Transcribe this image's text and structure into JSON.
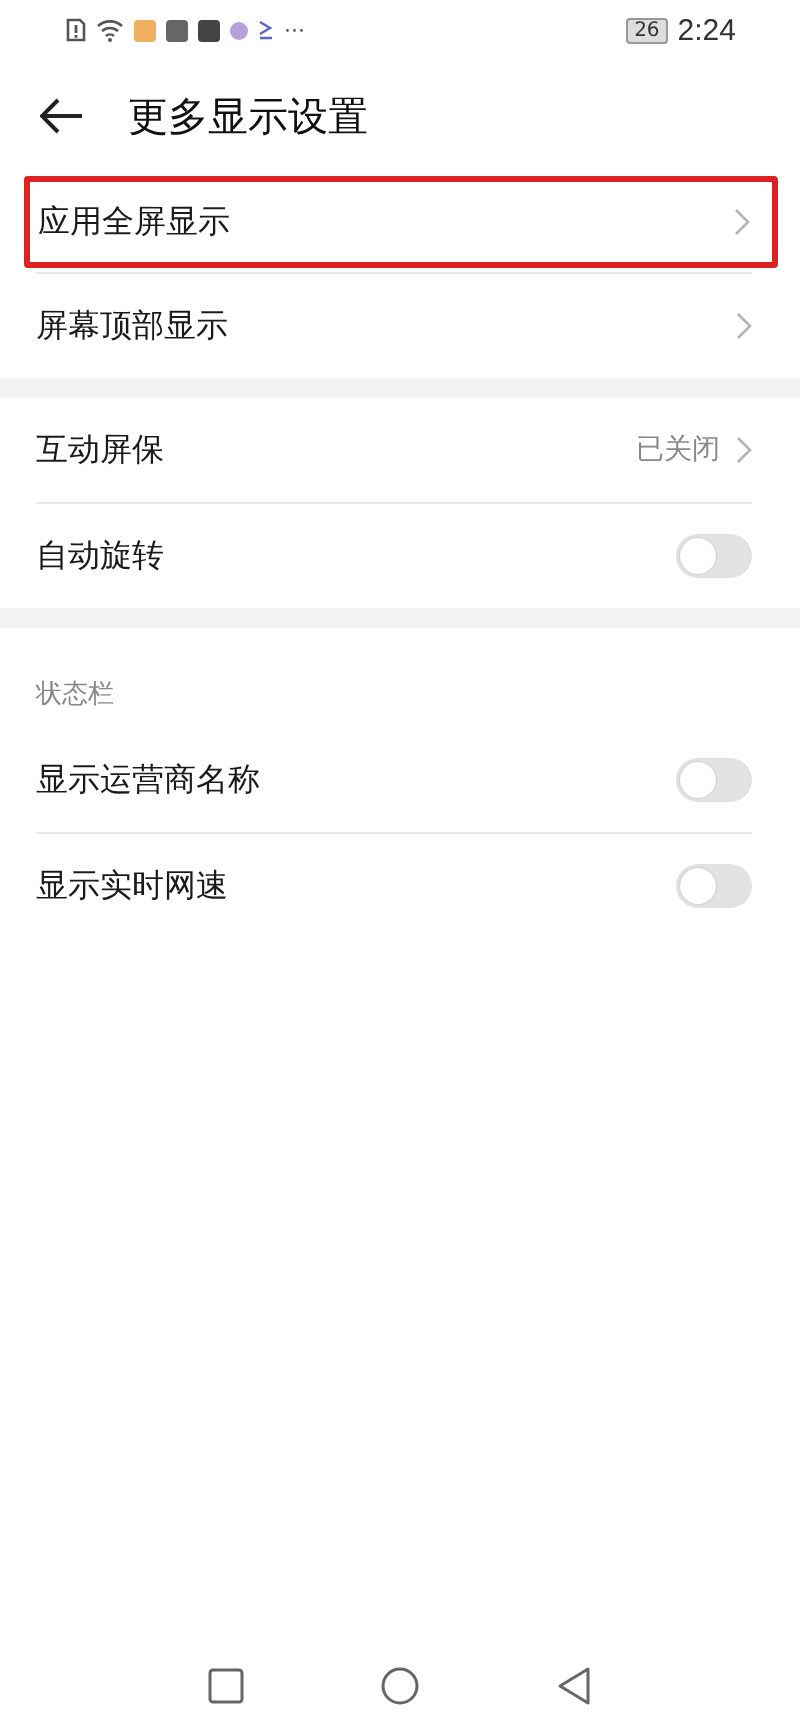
{
  "status_bar": {
    "more": "···",
    "battery": "26",
    "time": "2:24"
  },
  "header": {
    "title": "更多显示设置"
  },
  "groups": [
    {
      "items": [
        {
          "kind": "link",
          "label": "应用全屏显示",
          "highlighted": true
        },
        {
          "kind": "link",
          "label": "屏幕顶部显示",
          "highlighted": false
        }
      ]
    },
    {
      "items": [
        {
          "kind": "link",
          "label": "互动屏保",
          "value": "已关闭",
          "highlighted": false
        },
        {
          "kind": "switch",
          "label": "自动旋转",
          "on": false
        }
      ]
    },
    {
      "title": "状态栏",
      "items": [
        {
          "kind": "switch",
          "label": "显示运营商名称",
          "on": false
        },
        {
          "kind": "switch",
          "label": "显示实时网速",
          "on": false
        }
      ]
    }
  ]
}
